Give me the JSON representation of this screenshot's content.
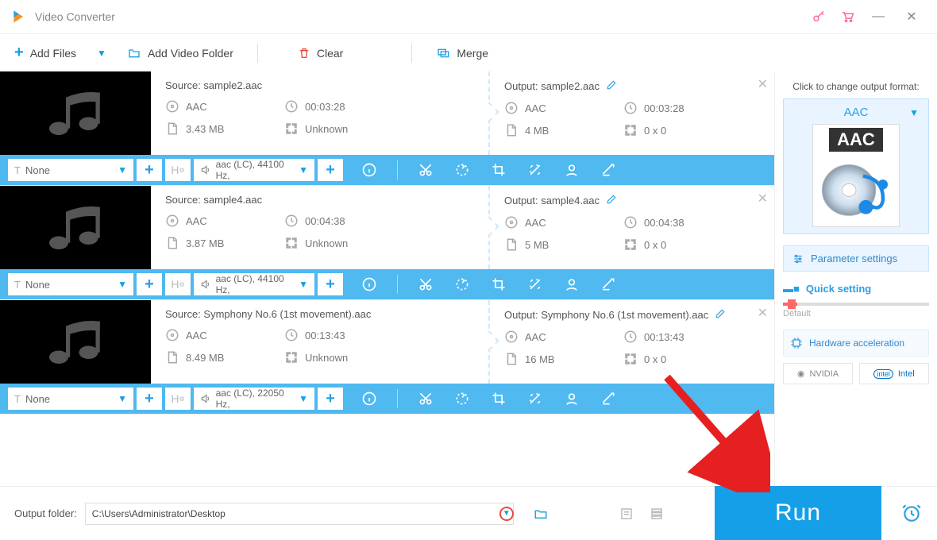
{
  "title": "Video Converter",
  "toolbar": {
    "add_files": "Add Files",
    "add_folder": "Add Video Folder",
    "clear": "Clear",
    "merge": "Merge"
  },
  "items": [
    {
      "source_label": "Source: sample2.aac",
      "output_label": "Output: sample2.aac",
      "src_fmt": "AAC",
      "src_dur": "00:03:28",
      "src_size": "3.43 MB",
      "src_dim": "Unknown",
      "out_fmt": "AAC",
      "out_dur": "00:03:28",
      "out_size": "4 MB",
      "out_dim": "0 x 0",
      "subtitle_sel": "None",
      "codec": "aac (LC), 44100 Hz,"
    },
    {
      "source_label": "Source: sample4.aac",
      "output_label": "Output: sample4.aac",
      "src_fmt": "AAC",
      "src_dur": "00:04:38",
      "src_size": "3.87 MB",
      "src_dim": "Unknown",
      "out_fmt": "AAC",
      "out_dur": "00:04:38",
      "out_size": "5 MB",
      "out_dim": "0 x 0",
      "subtitle_sel": "None",
      "codec": "aac (LC), 44100 Hz,"
    },
    {
      "source_label": "Source: Symphony No.6 (1st movement).aac",
      "output_label": "Output: Symphony No.6 (1st movement).aac",
      "src_fmt": "AAC",
      "src_dur": "00:13:43",
      "src_size": "8.49 MB",
      "src_dim": "Unknown",
      "out_fmt": "AAC",
      "out_dur": "00:13:43",
      "out_size": "16 MB",
      "out_dim": "0 x 0",
      "subtitle_sel": "None",
      "codec": "aac (LC), 22050 Hz,"
    }
  ],
  "sidebar": {
    "click_label": "Click to change output format:",
    "format": "AAC",
    "format_badge": "AAC",
    "param_btn": "Parameter settings",
    "quick": "Quick setting",
    "default": "Default",
    "hw_accel": "Hardware acceleration",
    "nvidia": "NVIDIA",
    "intel": "Intel"
  },
  "footer": {
    "label": "Output folder:",
    "path": "C:\\Users\\Administrator\\Desktop",
    "run": "Run"
  }
}
